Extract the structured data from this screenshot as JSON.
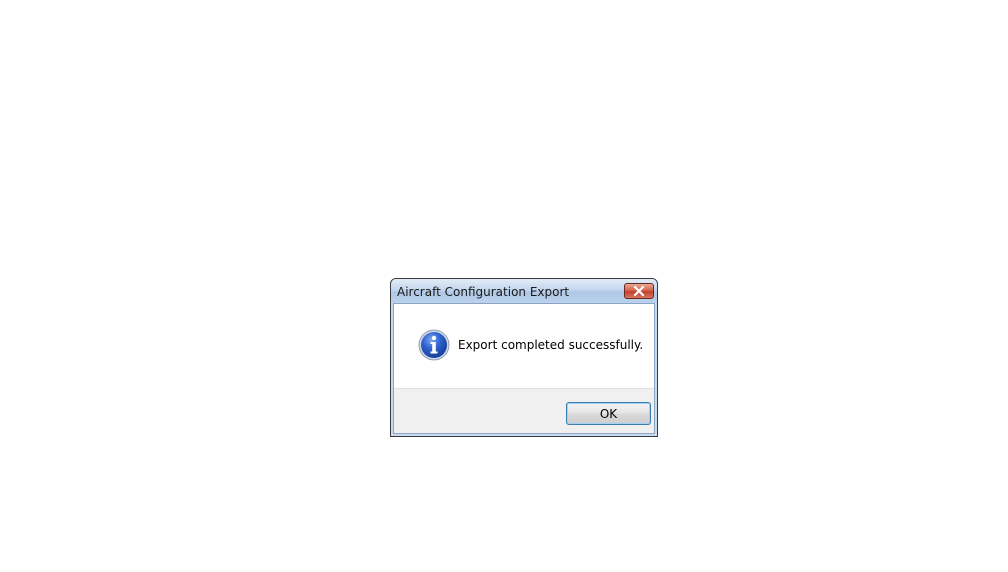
{
  "dialog": {
    "title": "Aircraft Configuration Export",
    "message": "Export completed successfully.",
    "icon": "information-icon",
    "close_icon": "close-icon",
    "ok_label": "OK"
  },
  "colors": {
    "close_button": "#c2412a",
    "info_icon_blue": "#2a5bc4",
    "ok_border": "#3c7fb1"
  }
}
